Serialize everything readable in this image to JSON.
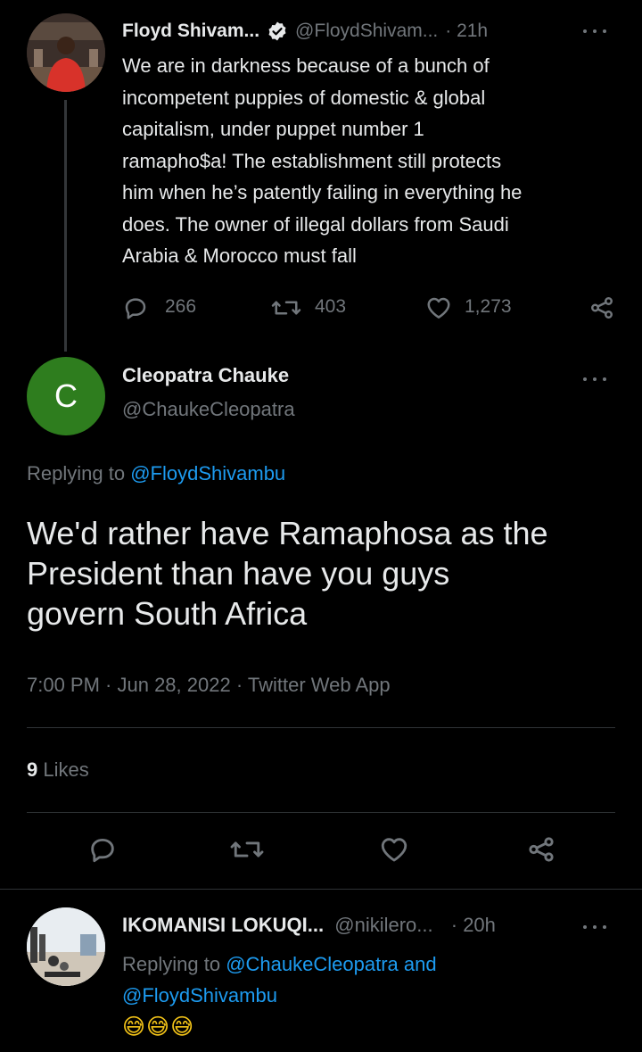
{
  "tweet1": {
    "name": "Floyd Shivam...",
    "handle": "@FloydShivam...",
    "time": "· 21h",
    "lines": [
      "We are in darkness because of a bunch of",
      "incompetent puppies of domestic & global",
      "capitalism, under puppet number 1",
      "ramapho$a! The establishment still protects",
      "him when he’s patently failing in everything he",
      "does. The owner of illegal dollars from Saudi",
      "Arabia & Morocco must fall"
    ],
    "replies": "266",
    "retweets": "403",
    "likes": "1,273"
  },
  "main": {
    "avatar_letter": "C",
    "name": "Cleopatra Chauke",
    "handle": "@ChaukeCleopatra",
    "replying_prefix": "Replying to",
    "replying_handle": "@FloydShivambu",
    "text_lines": [
      "We'd rather have Ramaphosa as the",
      "President than have you guys",
      "govern South Africa"
    ],
    "meta": "7:00 PM · Jun 28, 2022 · Twitter Web App",
    "likes_count": "9",
    "likes_label": "Likes"
  },
  "reply": {
    "name": "IKOMANISI LOKUQI...",
    "handle": "@nikilero...",
    "time": "· 20h",
    "replying_prefix": "Replying to",
    "replying_handle1": "@ChaukeCleopatra and",
    "replying_handle2": "@FloydShivambu",
    "emoji": "😅😅😅"
  },
  "colors": {
    "background": "#000000",
    "text": "#e7e9ea",
    "muted": "#71767b",
    "link": "#1d9bf0",
    "avatar_green": "#2e7d1e",
    "divider": "#2f3336"
  }
}
